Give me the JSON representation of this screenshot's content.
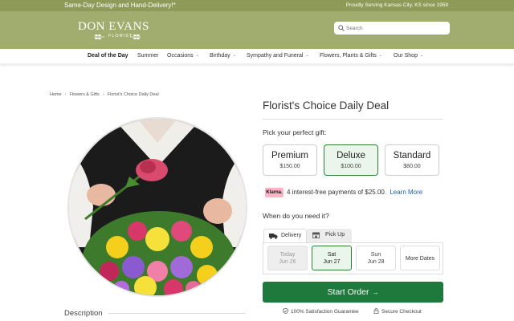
{
  "topbar": {
    "promo": "Same-Day Design and Hand-Delivery!*",
    "serving": "Proudly Serving Kansas City, KS since 1959"
  },
  "header": {
    "logo_name": "DON EVANS",
    "logo_sub": "FLORIST",
    "search_placeholder": "Search"
  },
  "nav": {
    "items": [
      {
        "label": "Deal of the Day"
      },
      {
        "label": "Summer"
      },
      {
        "label": "Occasions"
      },
      {
        "label": "Birthday"
      },
      {
        "label": "Sympathy and Funeral"
      },
      {
        "label": "Flowers, Plants & Gifts"
      },
      {
        "label": "Our Shop"
      }
    ]
  },
  "breadcrumb": [
    "Home",
    "Flowers & Gifts",
    "Florist's Choice Daily Deal"
  ],
  "product": {
    "title": "Florist's Choice Daily Deal",
    "pick_label": "Pick your perfect gift:",
    "options": [
      {
        "name": "Premium",
        "price": "$150.00"
      },
      {
        "name": "Deluxe",
        "price": "$100.00"
      },
      {
        "name": "Standard",
        "price": "$80.00"
      }
    ],
    "selected_option": "Deluxe"
  },
  "klarna": {
    "badge": "Klarna.",
    "text": "4 interest-free payments of $25.00.",
    "link": "Learn More"
  },
  "delivery": {
    "question": "When do you need it?",
    "tabs": [
      "Delivery",
      "Pick Up"
    ],
    "active_tab": "Delivery",
    "dates": [
      {
        "day": "Today",
        "date": "Jun 26"
      },
      {
        "day": "Sat",
        "date": "Jun 27"
      },
      {
        "day": "Sun",
        "date": "Jun 28"
      }
    ],
    "more_dates": "More Dates",
    "selected_date": "Jun 27"
  },
  "cta": {
    "start_order": "Start Order"
  },
  "guarantees": {
    "satisfaction": "100% Satisfaction Guarantee",
    "secure": "Secure Checkout"
  },
  "description_label": "Description",
  "colors": {
    "topbar": "#8d9a58",
    "header": "#a1ad6f",
    "primary_green": "#1e7a3c",
    "selected_border": "#2e7d32",
    "selected_bg": "#eaf6ec",
    "link": "#1a5fb4",
    "klarna_pink": "#ffb3c7"
  }
}
